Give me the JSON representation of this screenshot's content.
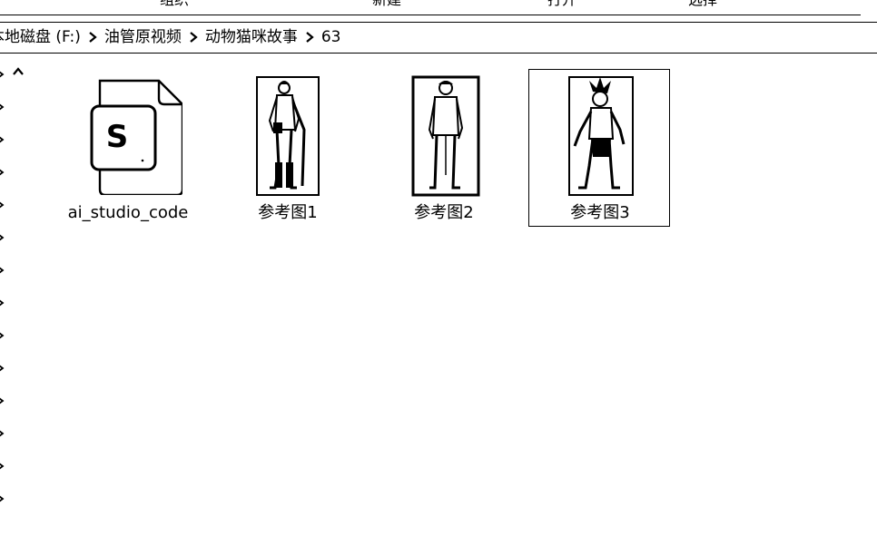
{
  "toolbar": {
    "items": [
      {
        "label": "组织"
      },
      {
        "label": "新建"
      },
      {
        "label": "打开"
      },
      {
        "label": "选择"
      }
    ]
  },
  "breadcrumb": {
    "items": [
      {
        "label": "本地磁盘 (F:)"
      },
      {
        "label": "油管原视频"
      },
      {
        "label": "动物猫咪故事"
      },
      {
        "label": "63"
      }
    ]
  },
  "files": [
    {
      "name": "ai_studio_code",
      "icon": "code-file-icon",
      "selected": false
    },
    {
      "name": "参考图1",
      "icon": "image-thumbnail",
      "selected": false
    },
    {
      "name": "参考图2",
      "icon": "image-thumbnail",
      "selected": false
    },
    {
      "name": "参考图3",
      "icon": "image-thumbnail",
      "selected": true
    }
  ],
  "code_file_icon_letter": "S"
}
